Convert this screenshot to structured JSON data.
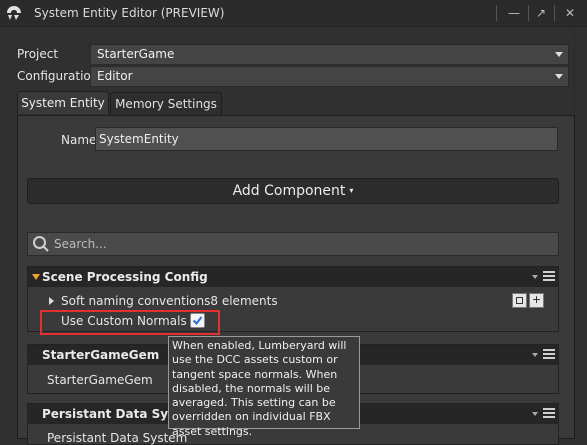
{
  "window": {
    "title": "System Entity Editor (PREVIEW)",
    "minimize_glyph": "—",
    "float_glyph": "↗",
    "close_glyph": "✕"
  },
  "form": {
    "project_label": "Project",
    "project_value": "StarterGame",
    "configuration_label": "Configuration",
    "configuration_value": "Editor"
  },
  "tabs": [
    {
      "label": "System Entity",
      "active": true
    },
    {
      "label": "Memory Settings",
      "active": false
    }
  ],
  "entity": {
    "name_label": "Name",
    "name_value": "SystemEntity"
  },
  "add_component": {
    "label": "Add Component",
    "caret": "▾"
  },
  "search": {
    "placeholder": "Search..."
  },
  "components": [
    {
      "title": "Scene Processing Config",
      "rows": [
        {
          "label": "Soft naming conventions",
          "value": "8 elements"
        },
        {
          "label": "Use Custom Normals",
          "checked": true
        }
      ],
      "add_glyph": "+"
    },
    {
      "title": "StarterGameGem",
      "rows": [
        {
          "label": "StarterGameGem"
        }
      ]
    },
    {
      "title": "Persistant Data System",
      "rows": [
        {
          "label": "Persistant Data System"
        }
      ]
    }
  ],
  "tooltip": {
    "text": "When enabled, Lumberyard will use the DCC assets custom or tangent space normals. When disabled, the normals will be averaged. This setting can be overridden on individual FBX asset settings."
  },
  "colors": {
    "accent_orange": "#f0a030",
    "highlight_red": "#e03030",
    "checkbox_blue": "#2a6fd6"
  }
}
